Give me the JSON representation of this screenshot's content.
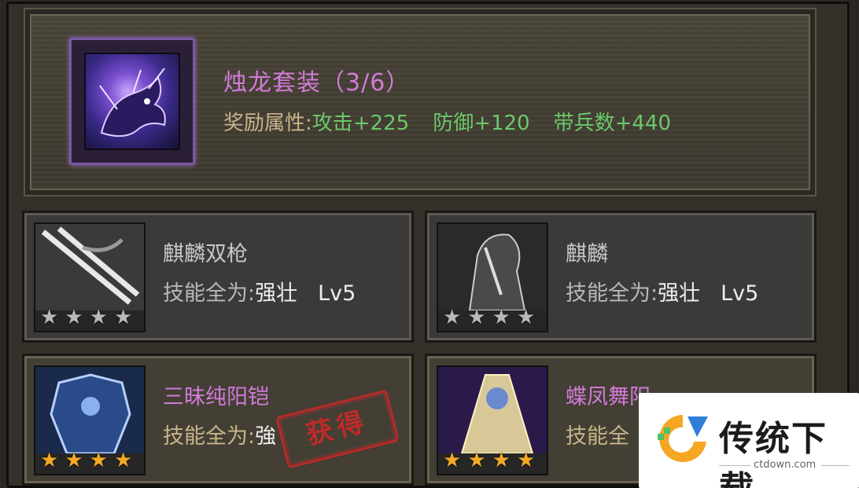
{
  "set": {
    "title": "烛龙套装（3/6）",
    "bonus_label": "奖励属性:",
    "bonus_attack": "攻击+225",
    "bonus_defense": "防御+120",
    "bonus_troops": "带兵数+440",
    "icon": "dragon-icon"
  },
  "items": [
    {
      "name": "麒麟双枪",
      "skill_label": "技能全为:",
      "skill_value": "强壮",
      "level": "Lv5",
      "stars": 4,
      "star_color": "grey",
      "icon": "spear-icon"
    },
    {
      "name": "麒麟",
      "skill_label": "技能全为:",
      "skill_value": "强壮",
      "level": "Lv5",
      "stars": 4,
      "star_color": "grey",
      "icon": "horse-icon"
    },
    {
      "name": "三昧纯阳铠",
      "skill_label": "技能全为:",
      "skill_value": "強",
      "stars": 4,
      "star_color": "gold",
      "icon": "armor-icon"
    },
    {
      "name": "蝶凤舞阳",
      "skill_label": "技能全",
      "stars": 4,
      "star_color": "gold",
      "icon": "banner-icon"
    }
  ],
  "stamp": {
    "text": "获得"
  },
  "watermark": {
    "title": "传统下载",
    "url": "ctdown.com"
  },
  "colors": {
    "pink": "#d27ad8",
    "green": "#6cc86a",
    "gold_star": "#f2a928",
    "stamp_red": "#cd2828"
  }
}
